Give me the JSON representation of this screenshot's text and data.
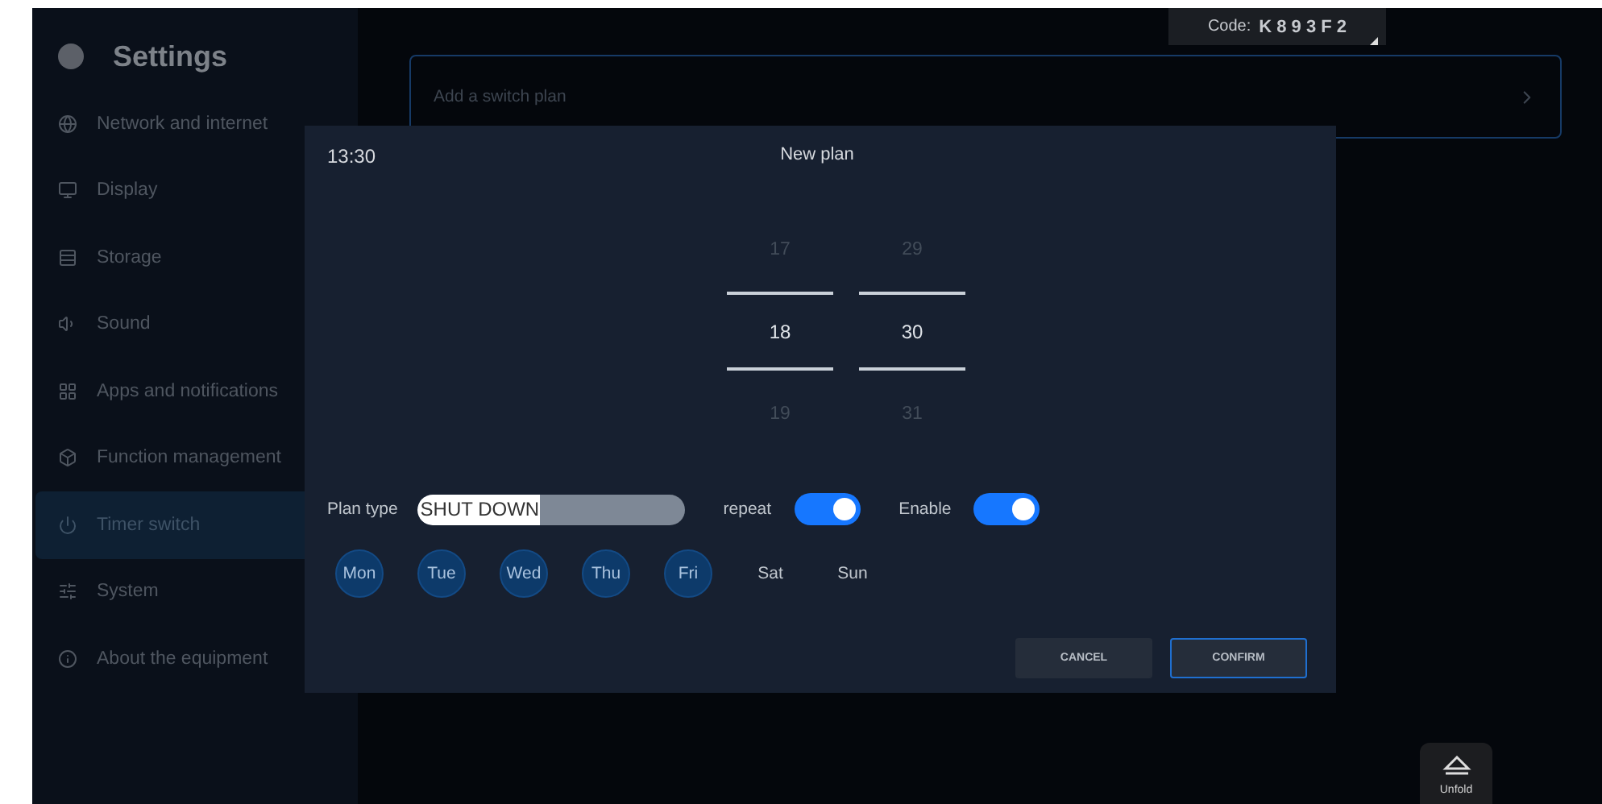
{
  "sidebar": {
    "title": "Settings",
    "items": [
      {
        "label": "Network and internet",
        "selected": false
      },
      {
        "label": "Display",
        "selected": false
      },
      {
        "label": "Storage",
        "selected": false
      },
      {
        "label": "Sound",
        "selected": false
      },
      {
        "label": "Apps and notifications",
        "selected": false
      },
      {
        "label": "Function management",
        "selected": false
      },
      {
        "label": "Timer switch",
        "selected": true
      },
      {
        "label": "System",
        "selected": false
      },
      {
        "label": "About the equipment",
        "selected": false
      }
    ]
  },
  "code_tag": {
    "label": "Code:",
    "value": "K 8 9 3 F 2"
  },
  "add_plan": {
    "label": "Add a switch plan"
  },
  "dialog": {
    "time": "13:30",
    "title": "New plan",
    "picker": [
      {
        "above": "17",
        "value": "18",
        "below": "19"
      },
      {
        "above": "29",
        "value": "30",
        "below": "31"
      }
    ],
    "plan_type": {
      "label": "Plan type",
      "value": "SHUT DOWN"
    },
    "toggles": [
      {
        "label": "repeat",
        "on": true
      },
      {
        "label": "Enable",
        "on": true
      }
    ],
    "days": [
      {
        "label": "Mon",
        "selected": true
      },
      {
        "label": "Tue",
        "selected": true
      },
      {
        "label": "Wed",
        "selected": true
      },
      {
        "label": "Thu",
        "selected": true
      },
      {
        "label": "Fri",
        "selected": true
      },
      {
        "label": "Sat",
        "selected": false
      },
      {
        "label": "Sun",
        "selected": false
      }
    ],
    "buttons": [
      {
        "label": "CANCEL",
        "selected": false
      },
      {
        "label": "CONFIRM",
        "selected": true
      }
    ]
  },
  "unfold": {
    "label": "Unfold"
  }
}
